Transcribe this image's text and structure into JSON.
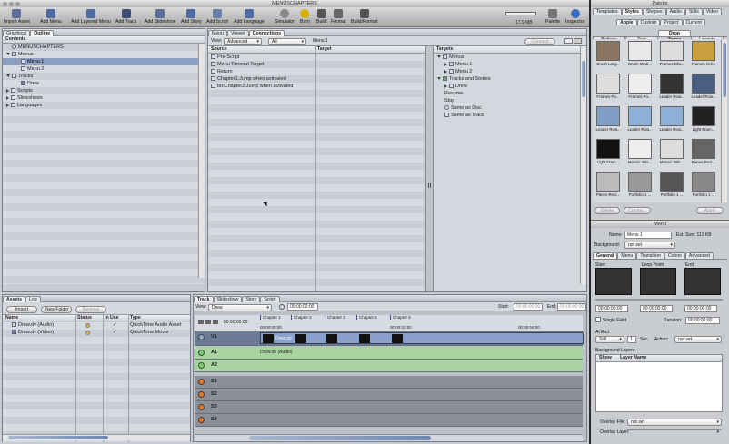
{
  "window": {
    "title": "MENUSCHAPTERS"
  },
  "toolbar": {
    "items": [
      "Import Asset",
      "Add Menu",
      "Add Layered Menu",
      "Add Track",
      "Add Slideshow",
      "Add Story",
      "Add Script",
      "Add Language",
      "Simulator",
      "Burn",
      "Build",
      "Format",
      "Build/Format",
      "Palette",
      "Inspector"
    ],
    "disk_usage": "17.9 MB"
  },
  "left_panel": {
    "tabs": [
      "Graphical",
      "Outline"
    ],
    "header": "Contents",
    "tree": [
      {
        "label": "MENUSCHAPTERS",
        "level": 0
      },
      {
        "label": "Menus",
        "level": 0
      },
      {
        "label": "Menu 1",
        "level": 1
      },
      {
        "label": "Menu 2",
        "level": 1
      },
      {
        "label": "Tracks",
        "level": 0
      },
      {
        "label": "Drew",
        "level": 1
      },
      {
        "label": "Scripts",
        "level": 0
      },
      {
        "label": "Slideshows",
        "level": 0
      },
      {
        "label": "Languages",
        "level": 0
      }
    ]
  },
  "center": {
    "tabs": [
      "Menu",
      "Viewer",
      "Connections"
    ],
    "view_label": "View:",
    "view_value": "Advanced",
    "filter_value": "All",
    "target_name": "Menu 1",
    "connect_button": "Connect",
    "col_source": "Source",
    "col_target": "Target",
    "col_targets": "Targets",
    "sources": [
      "Pre-Script",
      "Menu Timeout Target",
      "Return",
      "Chapter1:Jump when activated",
      "btnChapter2:Jump when activated"
    ],
    "targets": [
      "Menus",
      "Menu 1",
      "Menu 2",
      "Tracks and Stories",
      "Drew",
      "Resume",
      "Stop",
      "Same as Disc",
      "Same as Track"
    ]
  },
  "assets": {
    "tabs": [
      "Assets",
      "Log"
    ],
    "import_button": "Import",
    "new_folder_button": "New Folder",
    "remove_button": "Remove",
    "columns": [
      "Name",
      "Status",
      "In Use",
      "Type"
    ],
    "rows": [
      {
        "name": "Drew.dv (Audio)",
        "in_use": "✓",
        "type": "QuickTime Audio Asset"
      },
      {
        "name": "Drew.dv (Video)",
        "in_use": "✓",
        "type": "QuickTime Movie"
      }
    ]
  },
  "track_editor": {
    "tabs": [
      "Track",
      "Slideshow",
      "Story",
      "Script"
    ],
    "view_label": "View:",
    "view_value": "Drew",
    "timecode": "00:00:00:00",
    "start_label": "Start:",
    "start_value": "00:00:00:00",
    "end_label": "End:",
    "end_value": "00:00:00:00",
    "ruler_timecode": "00:00:00:00",
    "ruler": [
      "00:00:00:00",
      "00:00:02:00",
      "00:00:04:00"
    ],
    "chapters": [
      "Chapter 1",
      "Chapter 2",
      "Chapter 3",
      "Chapter 4",
      "Chapter 5"
    ],
    "tracks": [
      "V1",
      "A1",
      "A2",
      "S1",
      "S2",
      "S3",
      "S4"
    ],
    "video_clip": "Drew.dv",
    "audio_clip": "Drew.dv (Audio)"
  },
  "palette": {
    "title": "Palette",
    "tabs": [
      "Templates",
      "Styles",
      "Shapes",
      "Audio",
      "Stills",
      "Video"
    ],
    "subtabs": [
      "Apple",
      "Custom",
      "Project",
      "Current"
    ],
    "style_tabs": [
      "Buttons",
      "Text",
      "Drop Zones",
      "Layouts"
    ],
    "thumbs": [
      "Brush Larg...",
      "Brush Medi...",
      "Frames Gla...",
      "Frames Gol...",
      "Frames Po...",
      "Frames Po...",
      "Leader Row...",
      "Leader Row...",
      "Leader Row...",
      "Leader Row...",
      "Leader Row...",
      "Light Fram...",
      "Light Fram...",
      "Mosaic Win...",
      "Mosaic Win...",
      "Panes Rect...",
      "Panes Rect...",
      "Portfolio 1 ...",
      "Portfolio 1 ...",
      "Portfolio 1 ..."
    ],
    "buttons": [
      "Delete",
      "Create...",
      "Apply"
    ]
  },
  "inspector": {
    "title": "Menu",
    "name_label": "Name:",
    "name_value": "Menu 1",
    "est_size": "Est. Size: 113 KB",
    "background_label": "Background:",
    "background_value": "not set",
    "tabs": [
      "General",
      "Menu",
      "Transition",
      "Colors",
      "Advanced"
    ],
    "start_label": "Start:",
    "loop_label": "Loop Point:",
    "end_label": "End:",
    "timecodes": [
      "00:00:00:00",
      "00:00:00:00",
      "00:00:00:00"
    ],
    "single_field": "Single Field",
    "duration_label": "Duration:",
    "duration_value": "00:00:00:00",
    "at_end_label": "At End:",
    "at_end_value": "Still",
    "seconds_value": "1",
    "seconds_unit": "Sec",
    "action_label": "Action:",
    "action_value": "not set",
    "bg_layers": "Background Layers:",
    "col_show": "Show",
    "col_layer": "Layer Name",
    "overlay_file_label": "Overlay File:",
    "overlay_file_value": "not set",
    "overlay_layer_label": "Overlay Layer:"
  }
}
